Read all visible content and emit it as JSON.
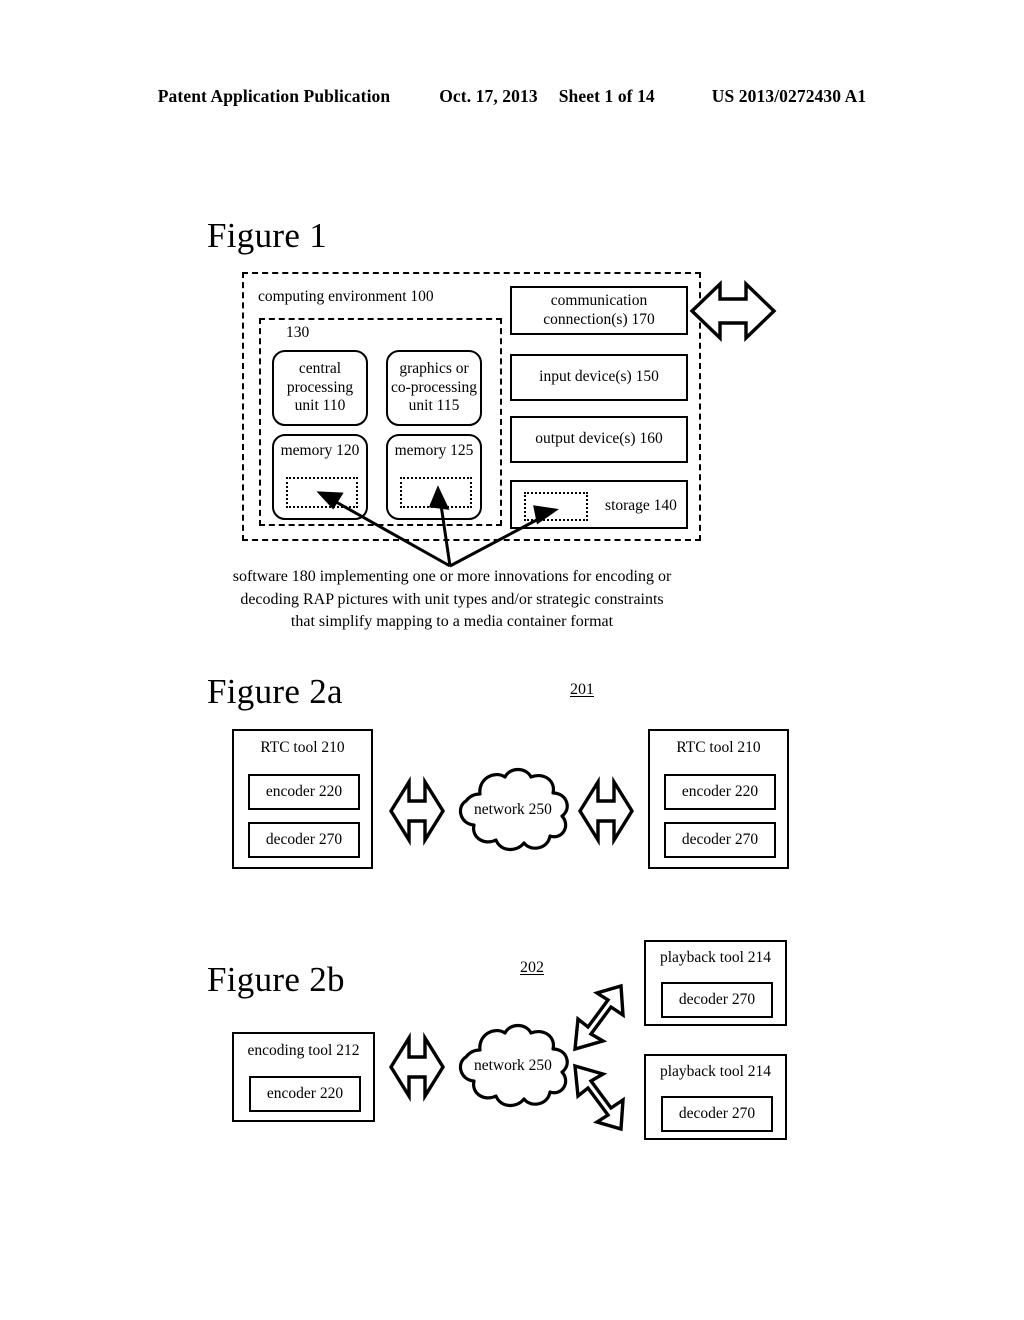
{
  "header": {
    "publication": "Patent Application Publication",
    "date": "Oct. 17, 2013",
    "sheet": "Sheet 1 of 14",
    "patent_number": "US 2013/0272430 A1"
  },
  "figure1": {
    "title": "Figure 1",
    "environment_label": "computing environment 100",
    "inner_group_label": "130",
    "boxes": {
      "cpu": "central\nprocessing\nunit 110",
      "gpu": "graphics or\nco-processing\nunit 115",
      "memory120": "memory 120",
      "memory125": "memory 125",
      "communication": "communication\nconnection(s) 170",
      "input": "input device(s) 150",
      "output": "output device(s) 160",
      "storage": "storage 140"
    },
    "caption": "software 180 implementing one or more innovations for encoding or\ndecoding RAP pictures with unit types and/or strategic constraints\nthat simplify mapping to a media container format",
    "icons": {
      "comm_arrow": "double-headed-arrow-icon"
    }
  },
  "figure2a": {
    "title": "Figure 2a",
    "reference_number": "201",
    "left_tool": {
      "label": "RTC tool 210",
      "encoder": "encoder 220",
      "decoder": "decoder 270"
    },
    "right_tool": {
      "label": "RTC tool 210",
      "encoder": "encoder 220",
      "decoder": "decoder 270"
    },
    "network": "network 250",
    "icons": {
      "left_arrow": "double-headed-arrow-icon",
      "right_arrow": "double-headed-arrow-icon",
      "cloud": "network-cloud-icon"
    }
  },
  "figure2b": {
    "title": "Figure 2b",
    "reference_number": "202",
    "encoding_tool": {
      "label": "encoding tool 212",
      "encoder": "encoder 220"
    },
    "network": "network 250",
    "playback_tools": [
      {
        "label": "playback tool 214",
        "decoder": "decoder 270"
      },
      {
        "label": "playback tool 214",
        "decoder": "decoder 270"
      }
    ],
    "icons": {
      "left_arrow": "double-headed-arrow-icon",
      "upper_arrow": "diagonal-double-headed-arrow-icon",
      "lower_arrow": "diagonal-double-headed-arrow-icon",
      "cloud": "network-cloud-icon"
    }
  },
  "colors": {
    "ink": "#000000",
    "paper": "#ffffff"
  }
}
